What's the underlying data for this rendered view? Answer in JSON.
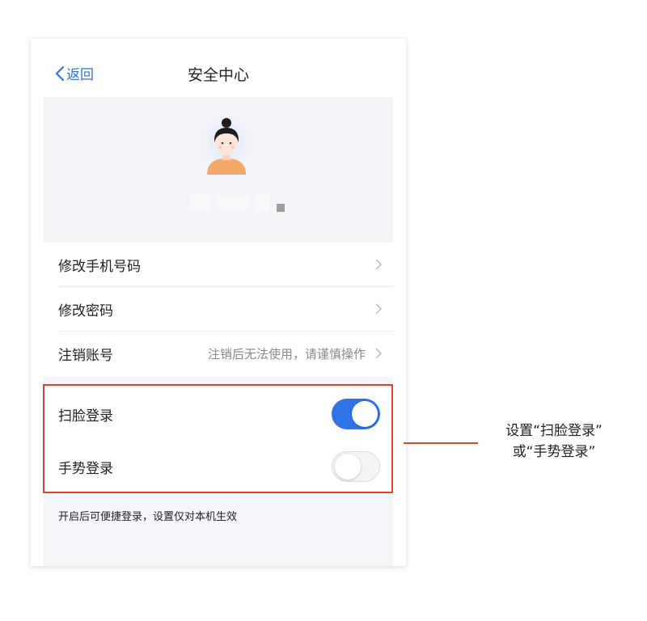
{
  "nav": {
    "back_label": "返回",
    "title": "安全中心"
  },
  "menu": {
    "items": [
      {
        "label": "修改手机号码",
        "hint": ""
      },
      {
        "label": "修改密码",
        "hint": ""
      },
      {
        "label": "注销账号",
        "hint": "注销后无法使用，请谨慎操作"
      }
    ]
  },
  "toggles": [
    {
      "label": "扫脸登录",
      "on": true
    },
    {
      "label": "手势登录",
      "on": false
    }
  ],
  "footer_note": "开启后可便捷登录，设置仅对本机生效",
  "annotation": {
    "line1": "设置“扫脸登录”",
    "line2": "或“手势登录”"
  },
  "colors": {
    "accent": "#2f73e6",
    "highlight": "#d2472d"
  },
  "icons": {
    "back": "chevron-left-icon",
    "row_arrow": "chevron-right-icon",
    "avatar": "user-avatar-icon"
  }
}
